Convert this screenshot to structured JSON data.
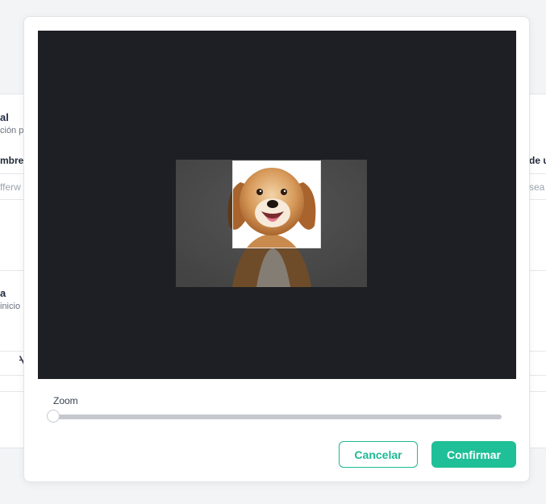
{
  "background": {
    "section1": {
      "title": "al",
      "subtitle": "ción p"
    },
    "field_left_label": "mbre",
    "field_left_value": "fferw",
    "field_right_label": "de u",
    "field_right_value": "sea",
    "section2": {
      "title": "a",
      "subtitle": "inicio"
    },
    "link_icon": "link-icon"
  },
  "cropper": {
    "image_subject": "dog-photo",
    "zoom": {
      "label": "Zoom",
      "value": 0
    }
  },
  "actions": {
    "cancel_label": "Cancelar",
    "confirm_label": "Confirmar"
  },
  "colors": {
    "accent": "#1fbf97",
    "crop_background": "#1e1f24",
    "track": "#c5c8ce"
  }
}
